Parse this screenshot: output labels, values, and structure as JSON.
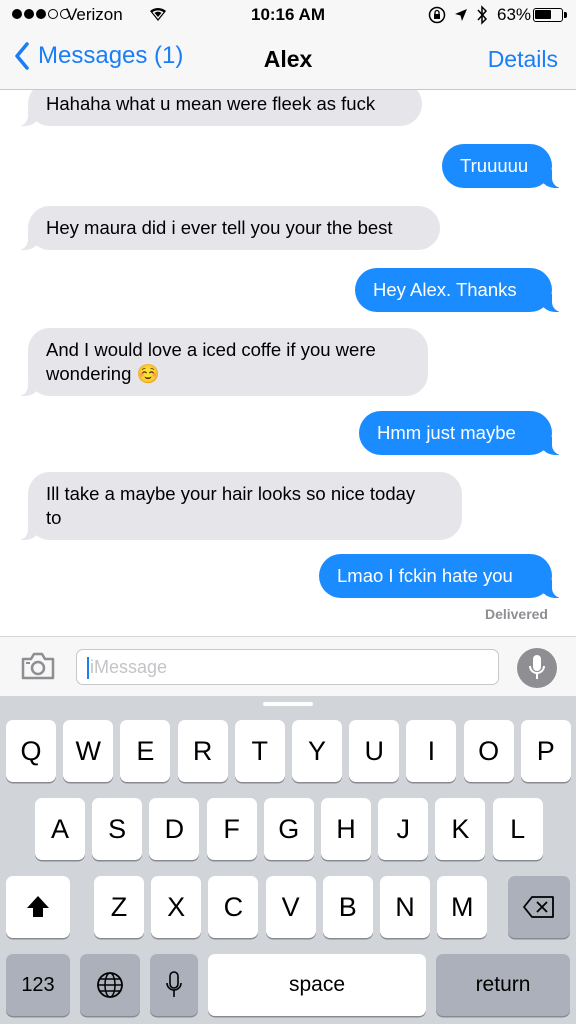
{
  "status_bar": {
    "signal_dots": 5,
    "signal_filled": 3,
    "carrier": "Verizon",
    "time": "10:16 AM",
    "battery_percent": "63%",
    "battery_level": 0.63,
    "icons": [
      "orientation-lock-icon",
      "location-arrow-icon",
      "bluetooth-icon"
    ]
  },
  "nav": {
    "back_label": "Messages (1)",
    "title": "Alex",
    "details_label": "Details"
  },
  "thread": {
    "messages": [
      {
        "direction": "incoming",
        "text": "Hahaha what u mean were fleek as fuck"
      },
      {
        "direction": "outgoing",
        "text": "Truuuuu"
      },
      {
        "direction": "incoming",
        "text": "Hey maura did i ever tell you your the best"
      },
      {
        "direction": "outgoing",
        "text": "Hey Alex. Thanks"
      },
      {
        "direction": "incoming",
        "text": "And I would love a iced coffe if you were\nwondering ☺️"
      },
      {
        "direction": "outgoing",
        "text": "Hmm just maybe"
      },
      {
        "direction": "incoming",
        "text": "Ill take a maybe your hair looks so nice today\nto"
      },
      {
        "direction": "outgoing",
        "text": "Lmao I fckin hate you"
      }
    ],
    "status": "Delivered"
  },
  "composer": {
    "placeholder": "iMessage"
  },
  "keyboard": {
    "row1": [
      "Q",
      "W",
      "E",
      "R",
      "T",
      "Y",
      "U",
      "I",
      "O",
      "P"
    ],
    "row2": [
      "A",
      "S",
      "D",
      "F",
      "G",
      "H",
      "J",
      "K",
      "L"
    ],
    "row3": [
      "Z",
      "X",
      "C",
      "V",
      "B",
      "N",
      "M"
    ],
    "numbers_label": "123",
    "space_label": "space",
    "return_label": "return"
  },
  "colors": {
    "accent_blue": "#1a7ef5",
    "outgoing_bubble": "#1a8cff",
    "incoming_bubble": "#e5e5ea",
    "keyboard_bg": "#d1d4d9"
  }
}
